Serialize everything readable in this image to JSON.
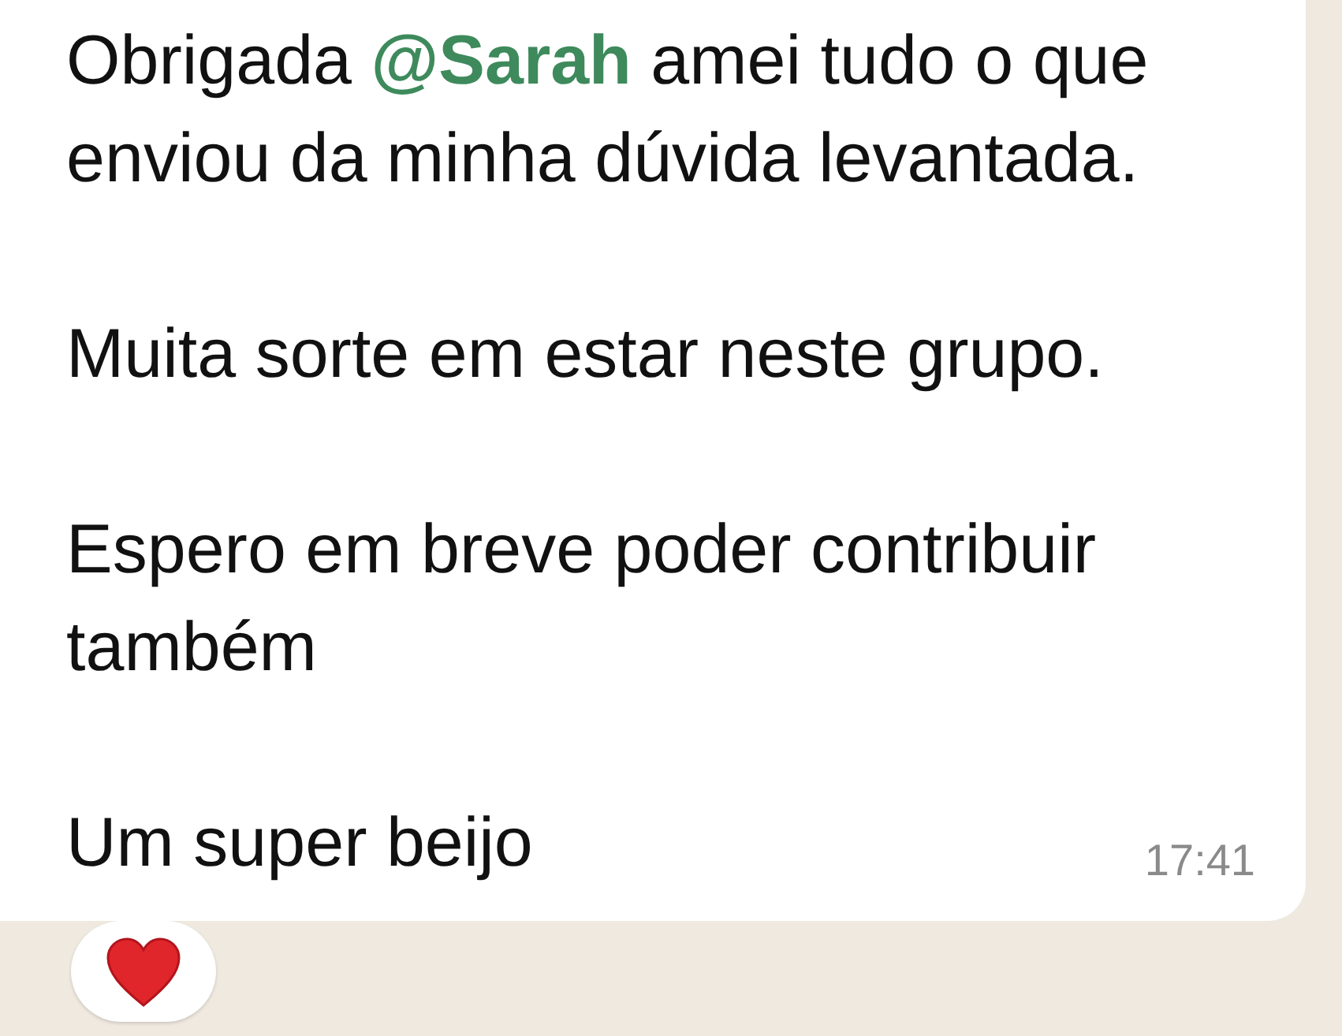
{
  "message": {
    "paragraphs": [
      {
        "segments": [
          {
            "kind": "text",
            "text": "Obrigada "
          },
          {
            "kind": "mention",
            "text": "@Sarah"
          },
          {
            "kind": "text",
            "text": " amei tudo o que enviou da minha dúvida levantada."
          }
        ]
      },
      {
        "segments": [
          {
            "kind": "text",
            "text": "Muita sorte em estar neste grupo."
          }
        ]
      },
      {
        "segments": [
          {
            "kind": "text",
            "text": "Espero em breve poder contribuir também"
          }
        ]
      },
      {
        "segments": [
          {
            "kind": "text",
            "text": "Um super beijo"
          }
        ]
      }
    ],
    "time": "17:41"
  }
}
